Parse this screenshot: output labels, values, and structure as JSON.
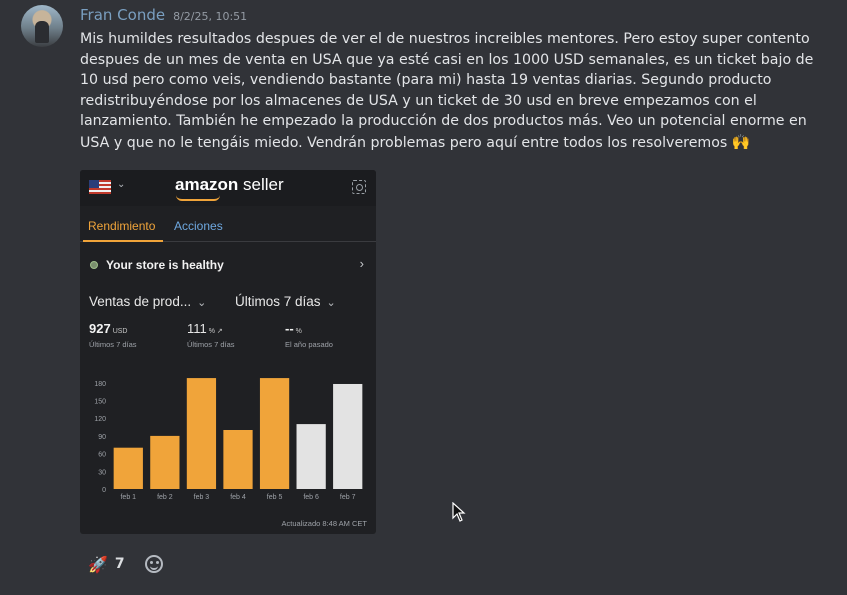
{
  "message": {
    "username": "Fran Conde",
    "timestamp": "8/2/25, 10:51",
    "text": "Mis humildes resultados despues de ver el de nuestros increibles mentores. Pero estoy super contento despues de un mes de venta en USA que ya esté casi en los 1000 USD semanales, es un ticket bajo de 10 usd pero como veis, vendiendo bastante (para mi) hasta 19 ventas diarias. Segundo producto redistribuyéndose por los almacenes de USA y un ticket de 30 usd en breve empezamos con el lanzamiento. También he empezado la producción de dos productos más. Veo un potencial enorme en USA y que no le tengáis miedo. Vendrán problemas pero aquí entre todos los resolveremos",
    "emoji": "🙌"
  },
  "screenshot": {
    "logo_main": "amazon",
    "logo_sub": " seller",
    "tabs": [
      "Rendimiento",
      "Acciones"
    ],
    "health_text": "Your store is healthy",
    "select_metric": "Ventas de prod...",
    "select_period": "Últimos 7 días",
    "stats": [
      {
        "value": "927",
        "unit": "USD",
        "sub": "Últimos 7 días"
      },
      {
        "value": "111",
        "unit": "% ↗",
        "sub": "Últimos 7 días"
      },
      {
        "value": "--",
        "unit": "%",
        "sub": "El año pasado"
      }
    ],
    "updated": "Actualizado 8:48 AM CET"
  },
  "chart_data": {
    "type": "bar",
    "categories": [
      "feb 1",
      "feb 2",
      "feb 3",
      "feb 4",
      "feb 5",
      "feb 6",
      "feb 7"
    ],
    "values": [
      70,
      90,
      188,
      100,
      188,
      110,
      178
    ],
    "colors": [
      "#f0a43a",
      "#f0a43a",
      "#f0a43a",
      "#f0a43a",
      "#f0a43a",
      "#e3e3e3",
      "#e3e3e3"
    ],
    "yticks": [
      0,
      30,
      60,
      90,
      120,
      150,
      180
    ],
    "ylim": [
      0,
      200
    ],
    "grid": false
  },
  "reaction": {
    "emoji": "🚀",
    "count": "7"
  },
  "colors": {
    "bg": "#313338",
    "accent": "#f0a43a",
    "link": "#6ea8e0",
    "username": "#7a9fc0"
  }
}
